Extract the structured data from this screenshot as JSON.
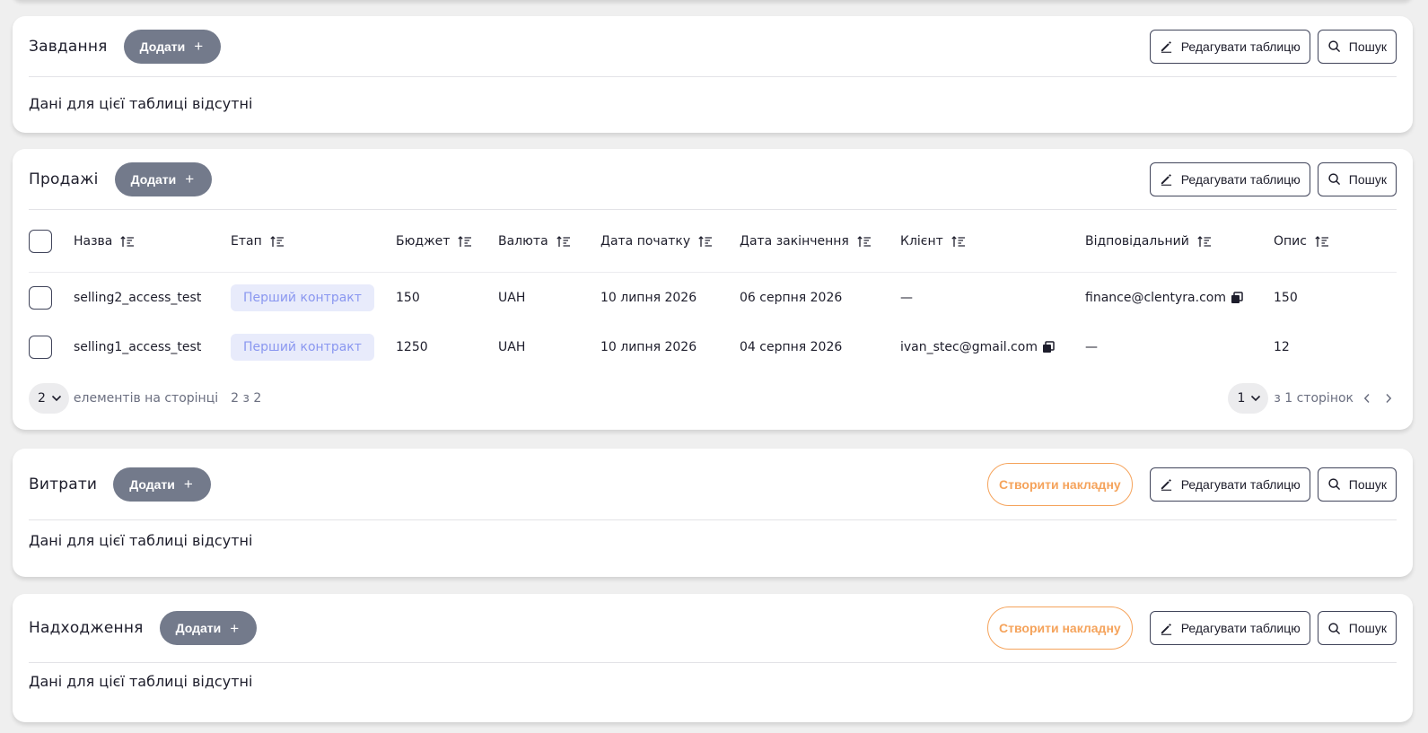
{
  "sections": [
    {
      "title": "Завдання",
      "add_label": "Додати",
      "edit_label": "Редагувати таблицю",
      "search_label": "Пошук",
      "empty_text": "Дані для цієї таблиці відсутні"
    },
    {
      "title": "Продажі",
      "add_label": "Додати",
      "edit_label": "Редагувати таблицю",
      "search_label": "Пошук",
      "columns": [
        "Назва",
        "Етап",
        "Бюджет",
        "Валюта",
        "Дата початку",
        "Дата закінчення",
        "Клієнт",
        "Відповідальний",
        "Опис"
      ],
      "rows": [
        {
          "name": "selling2_access_test",
          "stage": "Перший контракт",
          "budget": "150",
          "currency": "UAH",
          "start": "10 липня 2026",
          "end": "06 серпня 2026",
          "client": "—",
          "responsible": "finance@clentyra.com",
          "desc": "150"
        },
        {
          "name": "selling1_access_test",
          "stage": "Перший контракт",
          "budget": "1250",
          "currency": "UAH",
          "start": "10 липня 2026",
          "end": "04 серпня 2026",
          "client": "ivan_stec@gmail.com",
          "responsible": "—",
          "desc": "12"
        }
      ],
      "pager": {
        "per_page": "2",
        "per_page_label": "елементів на сторінці",
        "range": "2 з 2",
        "page": "1",
        "of_pages": "з 1 сторінок"
      }
    },
    {
      "title": "Витрати",
      "add_label": "Додати",
      "invoice_label": "Створити накладну",
      "edit_label": "Редагувати таблицю",
      "search_label": "Пошук",
      "empty_text": "Дані для цієї таблиці відсутні"
    },
    {
      "title": "Надходження",
      "add_label": "Додати",
      "invoice_label": "Створити накладну",
      "edit_label": "Редагувати таблицю",
      "search_label": "Пошук",
      "empty_text": "Дані для цієї таблиці відсутні"
    }
  ],
  "colors": {
    "add_button_bg": "#737a8b",
    "invoice_orange": "#f5a35b",
    "stage_badge_bg": "#e8ebfb",
    "stage_badge_text": "#8a97f0",
    "outline_border": "#40445a"
  },
  "icons": {
    "edit": "pencil-icon",
    "search": "search-icon",
    "sort": "sort-icon",
    "copy": "copy-icon",
    "dropdown": "chevron-down-icon",
    "prev": "chevron-left-icon",
    "next": "chevron-right-icon"
  }
}
